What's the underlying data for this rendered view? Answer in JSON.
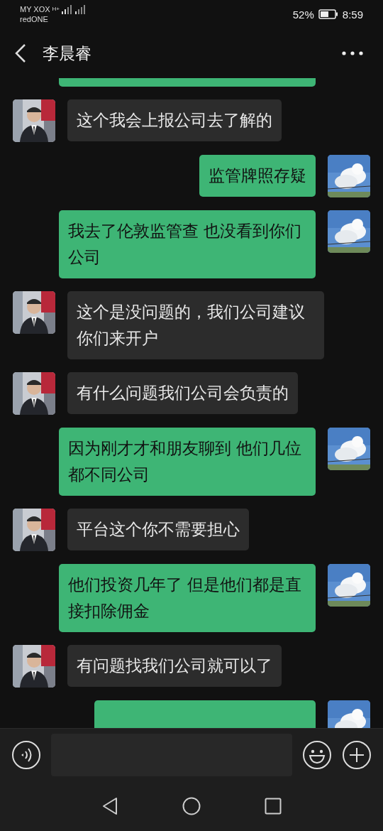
{
  "status_bar": {
    "carrier_1": "MY XOX",
    "network": "H+",
    "carrier_2": "redONE",
    "battery": "52%",
    "time": "8:59"
  },
  "header": {
    "title": "李晨睿"
  },
  "messages": [
    {
      "kind": "sent"
    },
    {
      "kind": "received",
      "text": "这个我会上报公司去了解的"
    },
    {
      "kind": "sent",
      "text": "监管牌照存疑"
    },
    {
      "kind": "sent",
      "text": "我去了伦敦监管查 也没看到你们公司"
    },
    {
      "kind": "received",
      "text": "这个是没问题的，我们公司建议你们来开户"
    },
    {
      "kind": "received",
      "text": "有什么问题我们公司会负责的"
    },
    {
      "kind": "sent",
      "text": "因为刚才才和朋友聊到 他们几位都不同公司"
    },
    {
      "kind": "received",
      "text": "平台这个你不需要担心"
    },
    {
      "kind": "sent",
      "text": "他们投资几年了 但是他们都是直接扣除佣金"
    },
    {
      "kind": "received",
      "text": "有问题找我们公司就可以了"
    },
    {
      "kind": "sent"
    }
  ]
}
